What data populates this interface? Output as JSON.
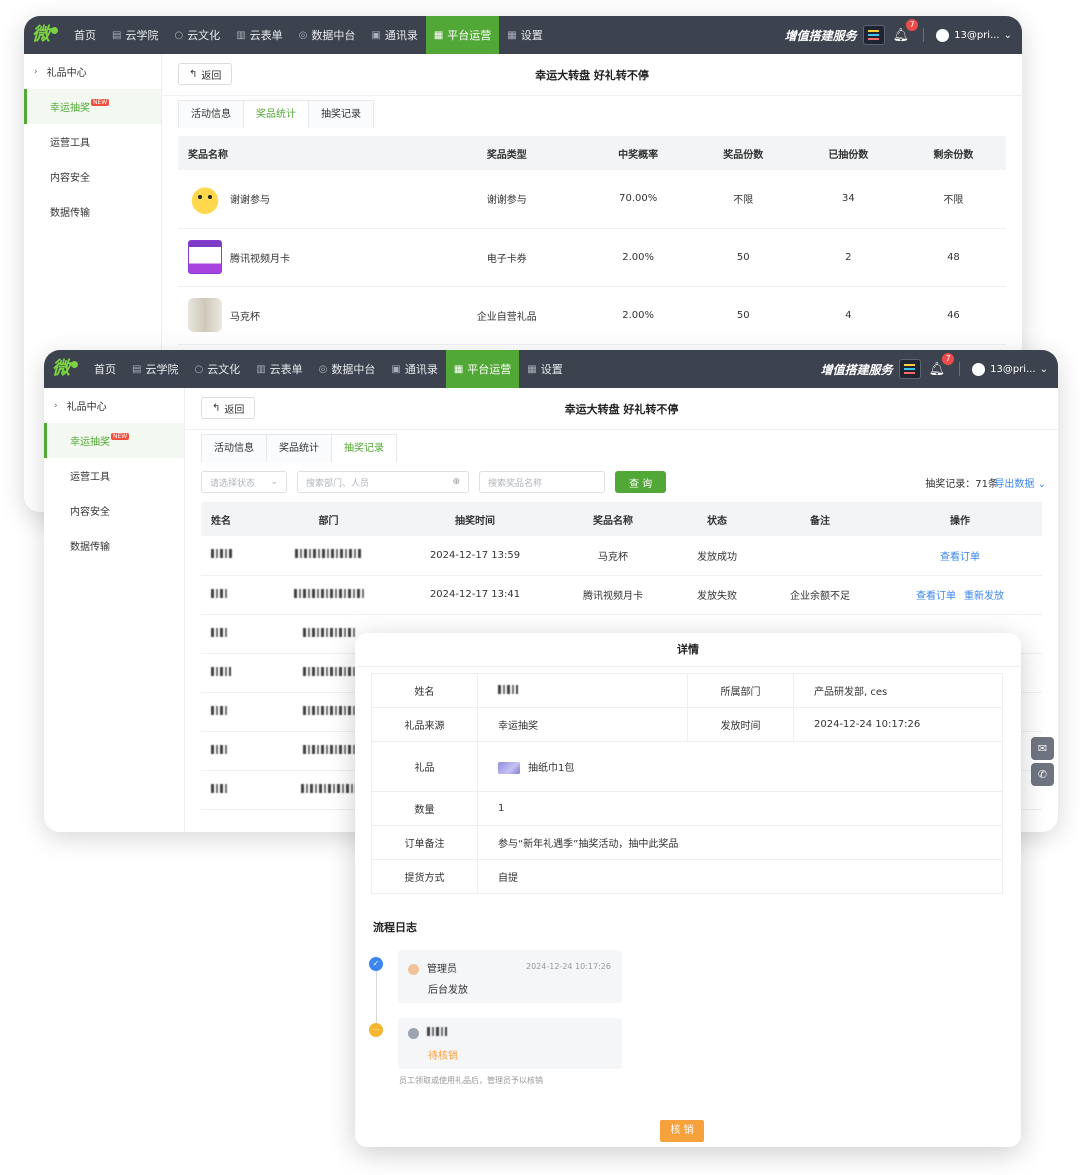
{
  "topbar": {
    "logo_text": "微",
    "nav": [
      {
        "icon": "",
        "label": "首页"
      },
      {
        "icon": "▤",
        "label": "云学院"
      },
      {
        "icon": "○",
        "label": "云文化"
      },
      {
        "icon": "▥",
        "label": "云表单"
      },
      {
        "icon": "◎",
        "label": "数据中台"
      },
      {
        "icon": "▣",
        "label": "通讯录"
      },
      {
        "icon": "▦",
        "label": "平台运营"
      },
      {
        "icon": "▦",
        "label": "设置"
      }
    ],
    "value_added": "增值搭建服务",
    "bell_count": "7",
    "user": "13@pri..."
  },
  "sidebar": {
    "parent": "礼品中心",
    "items": [
      "幸运抽奖",
      "运营工具",
      "内容安全",
      "数据传输"
    ],
    "new_badge": "NEW"
  },
  "common": {
    "back": "返回",
    "page_title": "幸运大转盘 好礼转不停",
    "tabs": [
      "活动信息",
      "奖品统计",
      "抽奖记录"
    ]
  },
  "stats": {
    "columns": [
      "奖品名称",
      "奖品类型",
      "中奖概率",
      "奖品份数",
      "已抽份数",
      "剩余份数"
    ],
    "rows": [
      {
        "name": "谢谢参与",
        "type": "谢谢参与",
        "rate": "70.00%",
        "total": "不限",
        "drawn": "34",
        "left": "不限"
      },
      {
        "name": "腾讯视频月卡",
        "type": "电子卡券",
        "rate": "2.00%",
        "total": "50",
        "drawn": "2",
        "left": "48"
      },
      {
        "name": "马克杯",
        "type": "企业自营礼品",
        "rate": "2.00%",
        "total": "50",
        "drawn": "4",
        "left": "46"
      }
    ]
  },
  "records": {
    "status_placeholder": "请选择状态",
    "dept_placeholder": "搜索部门、人员",
    "prize_placeholder": "搜索奖品名称",
    "query": "查 询",
    "count": "抽奖记录：71条",
    "export": "导出数据",
    "columns": [
      "姓名",
      "部门",
      "抽奖时间",
      "奖品名称",
      "状态",
      "备注",
      "操作"
    ],
    "rows": [
      {
        "time": "2024-12-17 13:59",
        "prize": "马克杯",
        "status": "发放成功",
        "note": "",
        "actions": [
          "查看订单"
        ]
      },
      {
        "time": "2024-12-17 13:41",
        "prize": "腾讯视频月卡",
        "status": "发放失败",
        "note": "企业余额不足",
        "actions": [
          "查看订单",
          "重新发放"
        ]
      }
    ]
  },
  "detail": {
    "title": "详情",
    "name_label": "姓名",
    "dept_label": "所属部门",
    "dept_value": "产品研发部, ces",
    "source_label": "礼品来源",
    "source_value": "幸运抽奖",
    "time_label": "发放时间",
    "time_value": "2024-12-24 10:17:26",
    "gift_label": "礼品",
    "gift_value": "抽纸巾1包",
    "qty_label": "数量",
    "qty_value": "1",
    "remark_label": "订单备注",
    "remark_value": "参与“新年礼遇季”抽奖活动，抽中此奖品",
    "pickup_label": "提货方式",
    "pickup_value": "自提",
    "log_title": "流程日志",
    "log": [
      {
        "who": "管理员",
        "time": "2024-12-24 10:17:26",
        "action": "后台发放"
      },
      {
        "who": "",
        "time": "",
        "action": "待核销"
      }
    ],
    "hint": "员工领取或使用礼品后，管理员予以核销",
    "verify": "核 销"
  }
}
